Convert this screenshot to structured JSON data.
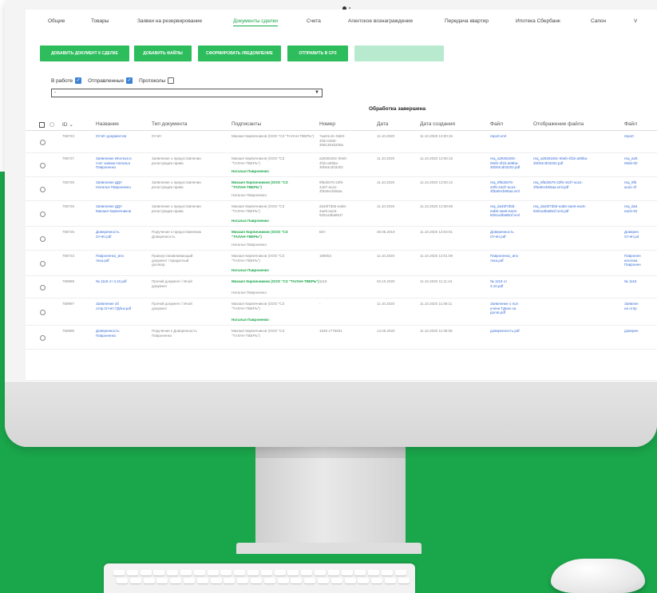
{
  "tabs": [
    {
      "label": "Общие"
    },
    {
      "label": "Товары"
    },
    {
      "label": "Заявки на резервирование"
    },
    {
      "label": "Документы сделки"
    },
    {
      "label": "Счета"
    },
    {
      "label": "Агентское вознаграждение"
    },
    {
      "label": "Передача квартир"
    },
    {
      "label": "Ипотека Сбербанк"
    },
    {
      "label": "Сапон"
    },
    {
      "label": "V"
    }
  ],
  "buttons": [
    {
      "label": "ДОБАВИТЬ ДОКУМЕНТ К СДЕЛКЕ"
    },
    {
      "label": "ДОБАВИТЬ ФАЙЛЫ"
    },
    {
      "label": "СФОРМИРОВАТЬ УВЕДОМЛЕНИЕ"
    },
    {
      "label": "ОТПРАВИТЬ В СРЗ"
    },
    {
      "label": ""
    }
  ],
  "filters": {
    "in_work": "В работе",
    "sent": "Отправленные",
    "protocols": "Протоколы",
    "in_work_checked": true,
    "sent_checked": true,
    "protocols_checked": false
  },
  "select": {
    "value": "-"
  },
  "status_text": "Обработка завершена",
  "table": {
    "headers": {
      "id": "ID",
      "name": "Название",
      "type": "Тип документа",
      "signers": "Подписанты",
      "number": "Номер",
      "date": "Дата",
      "created": "Дата создания",
      "file": "Файл",
      "display": "Отображение файла",
      "file2": "Файл"
    },
    "rows": [
      {
        "id": "759723",
        "name": "Отчёт документов",
        "type": "Отчёт",
        "signer1": "Михаил Кирпичников (ООО \"СЗ \"ТАЛАН-ТВЕРЬ\")",
        "signer2": "",
        "number": "7aa01c2c-0de0-\n4f1b-0290-\n30813045205a",
        "date": "11.10.2020",
        "created": "11.10.2020 13:00:15",
        "file": "report.xml",
        "display": "",
        "file2": "report"
      },
      {
        "id": "759727",
        "name": "Заявление Ипотека в\nсчет заявки Наталья\nПавроненко",
        "type": "Заявление о предоставлении\nрегистрации права",
        "signer1": "Михаил Кирпичников (ООО \"СЗ\n\"ТАЛАН-ТВЕРЬ\")",
        "signer2": "Наталья Павроненко",
        "number": "a2828180c-00eb-\n4f1b-a09ba-\n30004cd03202",
        "date": "11.10.2020",
        "created": "11.10.2020 13:00:15",
        "file": "req_a2828180c-\n00eb-4f1b-a09ba-\n30004cd03202.pdf",
        "display": "req_a2828180c-00eb-4f1b-a09ba-\n30004cd03202.pdf",
        "file2": "req_a28\n00eb-00"
      },
      {
        "id": "759726",
        "name": "Заявление ДДУ\nНаталья Павроненко",
        "type": "Заявление о предоставлении\nрегистрации права",
        "signer1": "Михаил Кирпичников (ООО \"СЗ\n\"ТАЛАН-ТВЕРЬ\")",
        "signer2": "Наталья Павроненко",
        "number": "9f5d4576-22f6-\n44d7-aca1-\n3f3a0ecb65aa",
        "date": "11.10.2020",
        "created": "11.10.2020 13:00:12",
        "file": "req_9f5d4576-\n22f6-44d7-aca1-\n3f3a0ecb65aa.xml",
        "display": "req_9f5d4576-22f6-44d7-aca1-\n3f3a0ecb65aa.xml.pdf",
        "file2": "req_9f5\naca1-3f"
      },
      {
        "id": "759725",
        "name": "Заявление ДДУ\nМихаил Кирпичников",
        "type": "Заявление о предоставлении\nрегистрации права",
        "signer1": "Михаил Кирпичников (ООО \"СЗ\n\"ТАЛАН-ТВЕРЬ\")",
        "signer2": "Наталья Павроненко",
        "number": "da45f7d5b-eab5-\n4ae5-eac5-\n9261a3ba851f",
        "date": "11.10.2020",
        "created": "11.10.2020 13:08:08",
        "file": "req_da45f7d5b-\neab5-4ae5-eac5-\n9261a3ba851f.xml",
        "display": "req_da45f7d5b-eab5-4ae5-eac5-\n9261a3ba851f.xml.pdf",
        "file2": "req_da4\neac5-92"
      },
      {
        "id": "759725",
        "name": "Доверенность\nОтчёт.pdf",
        "type": "Поручение к предоставлению\nДоверенность",
        "signer1": "Михаил Кирпичников (ООО \"СЗ\n\"ТАЛАН-ТВЕРЬ\")",
        "signer2": "Наталья Павроненко",
        "number": "Б/Н",
        "date": "30.05.2019",
        "created": "11.10.2020 13:04:01",
        "file": "Доверенность\nОтчёт.pdf",
        "display": "",
        "file2": "Доверен\nОтчёт.pd"
      },
      {
        "id": "759723",
        "name": "Павроненко_ипо\nтека.pdf",
        "type": "Правоустанавливающий\nдокумент / Кредитный\nдоговор",
        "signer1": "Михаил Кирпичников (ООО \"СЗ\n\"ТАЛАН-ТВЕРЬ\")",
        "signer2": "Наталья Павроненко",
        "number": "189053",
        "date": "11.10.2020",
        "created": "11.10.2020 13:01:09",
        "file": "Павроненко_ипо\nтека.pdf",
        "display": "",
        "file2": "Павронен\nипотека\nПавронен"
      },
      {
        "id": "759999",
        "name": "№ 1118 от 3.10.pdf",
        "type": "Прочий документ / Иной\nдокумент",
        "signer1": "Михаил Кирпичников (ООО \"СЗ \"ТАЛАН-ТВЕРЬ\")",
        "signer2": "Наталья Павроненко",
        "number": "1118",
        "date": "03.10.2020",
        "created": "11.10.2020 11:11:44",
        "file": "№ 1118 от\n3.10.pdf",
        "display": "",
        "file2": "№ 1118"
      },
      {
        "id": "759997",
        "name": "Заявление об\nотпр.Отчёт ГДбнк.pdf",
        "type": "Прочий документ / Иной\nдокумент",
        "signer1": "Михаил Кирпичников (ООО \"СЗ\n\"ТАЛАН-ТВЕРЬ\")",
        "signer2": "Наталья Павроненко",
        "number": "-",
        "date": "11.10.2020",
        "created": "11.10.2020 11:08:11",
        "file": "Заявление о пол\nучени ТДнке на\nдогов.pdf",
        "display": "",
        "file2": "Заявлен\nна отпр"
      },
      {
        "id": "759996",
        "name": "Доверенность\nПавроненко",
        "type": "Поручение к Доверенность\nПавроненко",
        "signer1": "Михаил Кирпичников (ООО \"СЗ\n\"ТАЛАН-ТВЕРЬ\")",
        "signer2": "",
        "number": "1849 1775601",
        "date": "14.05.2020",
        "created": "11.10.2020 11:08:08",
        "file": "доверенность.pdf",
        "display": "",
        "file2": "доверен"
      }
    ]
  },
  "colors": {
    "brand_green": "#1aa64b",
    "button_green": "#2ebd5c",
    "link_blue": "#3b6fd6"
  },
  "icons": {
    "camera": "camera-icon",
    "mouse": "magic-mouse-icon"
  }
}
